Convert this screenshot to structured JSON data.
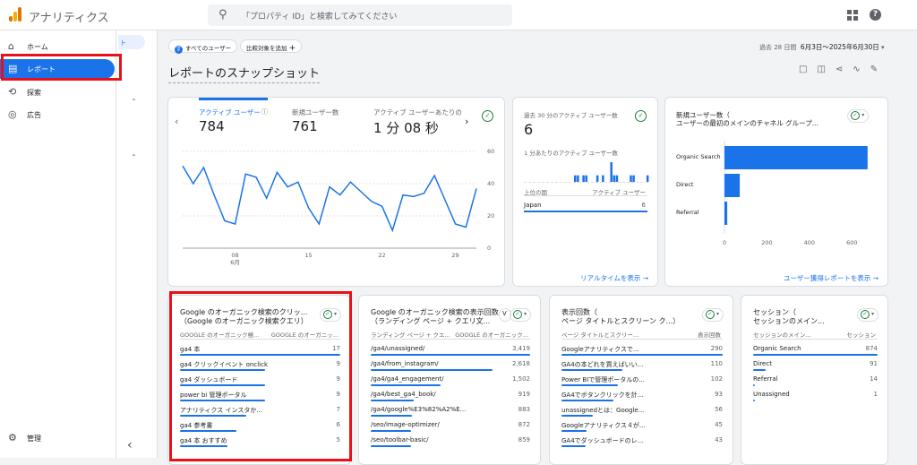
{
  "app": {
    "name": "アナリティクス"
  },
  "search": {
    "placeholder": "「プロパティ ID」と検索してみてください"
  },
  "sidebar": {
    "items": [
      {
        "label": "ホーム",
        "icon": "home-icon"
      },
      {
        "label": "レポート",
        "icon": "reports-icon",
        "active": true
      },
      {
        "label": "探索",
        "icon": "explore-icon"
      },
      {
        "label": "広告",
        "icon": "advertising-icon"
      }
    ],
    "admin_label": "管理",
    "sub_chip": "ト"
  },
  "toolbar": {
    "all_users_chip": "すべてのユーザー",
    "all_users_avatar": "す",
    "add_comparison": "比較対象を追加",
    "date_prefix": "過去 28 日間",
    "date_range": "6月3日～2025年6月30日"
  },
  "page": {
    "title": "レポートのスナップショット"
  },
  "overview_card": {
    "metrics": [
      {
        "label": "アクティブ ユーザー",
        "value": "784",
        "active": true
      },
      {
        "label": "新規ユーザー数",
        "value": "761"
      },
      {
        "label": "アクティブ ユーザーあたりの",
        "value": "1 分 08 秒"
      }
    ],
    "x_ticks": [
      "08",
      "15",
      "22",
      "29"
    ],
    "x_month": "6月",
    "y_ticks": [
      "60",
      "40",
      "20",
      "0"
    ]
  },
  "chart_data": {
    "type": "line",
    "x": [
      "6/3",
      "6/4",
      "6/5",
      "6/6",
      "6/7",
      "6/8",
      "6/9",
      "6/10",
      "6/11",
      "6/12",
      "6/13",
      "6/14",
      "6/15",
      "6/16",
      "6/17",
      "6/18",
      "6/19",
      "6/20",
      "6/21",
      "6/22",
      "6/23",
      "6/24",
      "6/25",
      "6/26",
      "6/27",
      "6/28",
      "6/29",
      "6/30"
    ],
    "series": [
      {
        "values": [
          51,
          40,
          50,
          33,
          17,
          15,
          46,
          44,
          31,
          47,
          38,
          41,
          25,
          15,
          38,
          33,
          41,
          35,
          29,
          26,
          11,
          33,
          32,
          34,
          45,
          30,
          15,
          13,
          37
        ]
      }
    ],
    "ylim": [
      0,
      60
    ],
    "grid": true
  },
  "realtime_card": {
    "title": "過去 30 分のアクティブ ユーザー数",
    "value": "6",
    "per_minute_label": "1 分あたりのアクティブ ユーザー数",
    "per_minute_bars": [
      0,
      0,
      0,
      0,
      0,
      0,
      0,
      0,
      0,
      0,
      0,
      0,
      0,
      0,
      0,
      0,
      0,
      0,
      1,
      1,
      0,
      1,
      1,
      0,
      0,
      0,
      1,
      0,
      1,
      0,
      0,
      3,
      1,
      1,
      0,
      0,
      0,
      0,
      1,
      1,
      0,
      0,
      0,
      0,
      1
    ],
    "col_country": "上位の国",
    "col_users": "アクティブ ユーザー",
    "rows": [
      {
        "country": "Japan",
        "users": "6"
      }
    ],
    "link": "リアルタイムを表示 →"
  },
  "channel_card": {
    "title_line1": "新規ユーザー数（",
    "title_line2": "ユーザーの最初のメインのチャネル グループ...",
    "link": "ユーザー獲得レポートを表示 →",
    "x_ticks": [
      "0",
      "200",
      "400",
      "600"
    ]
  },
  "channel_chart": {
    "type": "bar",
    "categories": [
      "Organic Search",
      "Direct",
      "Referral"
    ],
    "values": [
      674,
      72,
      13
    ],
    "xlim": [
      0,
      700
    ]
  },
  "tables": [
    {
      "title_line1": "Google のオーガニック検索のクリッ...",
      "title_line2": "（Google のオーガニック検索クエリ）",
      "col1": "GOOGLE のオーガニック検...",
      "col2": "GOOGLE のオーガニッ...",
      "rows": [
        {
          "k": "ga4 本",
          "v": "17"
        },
        {
          "k": "ga4 クリックイベント onclick",
          "v": "9"
        },
        {
          "k": "ga4 ダッシュボード",
          "v": "9"
        },
        {
          "k": "power bi 管理ポータル",
          "v": "9"
        },
        {
          "k": "アナリティクス インスタか...",
          "v": "7"
        },
        {
          "k": "ga4 参考書",
          "v": "6"
        },
        {
          "k": "ga4 本 おすすめ",
          "v": "5"
        }
      ],
      "max": 17
    },
    {
      "title_line1": "Google のオーガニック検索の表示回数",
      "title_line2": "（ランディング ページ + クエリ文...",
      "col1": "ランディング ページ + クエ...",
      "col2": "GOOGLE のオーガニック...",
      "rows": [
        {
          "k": "/ga4/unassigned/",
          "v": "3,419"
        },
        {
          "k": "/ga4/from_instagram/",
          "v": "2,618"
        },
        {
          "k": "/ga4/ga4_engagement/",
          "v": "1,502"
        },
        {
          "k": "/ga4/best_ga4_book/",
          "v": "919"
        },
        {
          "k": "/ga4/google%E3%82%A2%E...",
          "v": "883"
        },
        {
          "k": "/seo/image-optimizer/",
          "v": "872"
        },
        {
          "k": "/seo/toolbar-basic/",
          "v": "859"
        }
      ],
      "max": 3419
    },
    {
      "title_line1": "表示回数（",
      "title_line2": "ページ タイトルとスクリーン ク...）",
      "col1": "ページ タイトルとスクリー...",
      "col2": "表示回数",
      "rows": [
        {
          "k": "Googleアナリティクスで...",
          "v": "290"
        },
        {
          "k": "GA4の本どれを買えばいい...",
          "v": "110"
        },
        {
          "k": "Power BIで管理ポータルの...",
          "v": "102"
        },
        {
          "k": "GA4でボタンクリックを計...",
          "v": "93"
        },
        {
          "k": "unassignedとは：Google...",
          "v": "56"
        },
        {
          "k": "Googleアナリティクス４が...",
          "v": "45"
        },
        {
          "k": "GA4でダッシュボードのレ...",
          "v": "43"
        }
      ],
      "max": 290
    },
    {
      "title_line1": "セッション（",
      "title_line2": "セッションのメイン...",
      "col1": "セッションのメイン...",
      "col2": "セッション",
      "rows": [
        {
          "k": "Organic Search",
          "v": "874"
        },
        {
          "k": "Direct",
          "v": "91"
        },
        {
          "k": "Referral",
          "v": "14"
        },
        {
          "k": "Unassigned",
          "v": "1"
        }
      ],
      "max": 874
    }
  ],
  "colors": {
    "accent": "#1a73e8",
    "highlight": "#e8111a",
    "compare": "#188038"
  }
}
